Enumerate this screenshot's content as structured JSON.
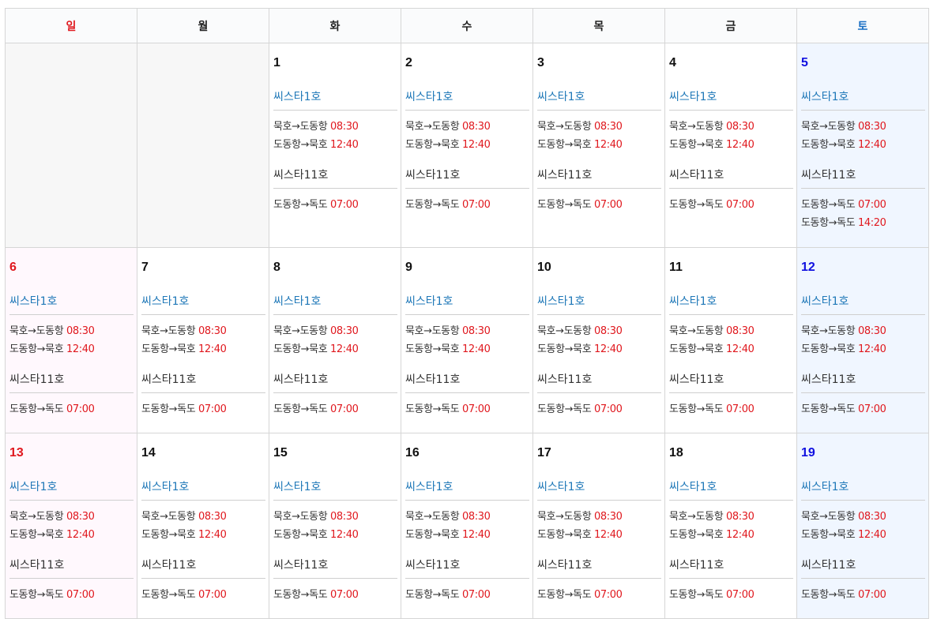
{
  "weekdays": [
    "일",
    "월",
    "화",
    "수",
    "목",
    "금",
    "토"
  ],
  "ships": {
    "ship1": "씨스타1호",
    "ship2": "씨스타11호"
  },
  "routes": {
    "mukho_dodong": "묵호→도동항",
    "dodong_mukho": "도동항→묵호",
    "dodong_dokdo": "도동항→독도"
  },
  "colors": {
    "sunday": "#e0181e",
    "saturday": "#1010e0",
    "time": "#e0181e",
    "ship1": "#1f78b8"
  },
  "weeks": [
    [
      null,
      null,
      {
        "day": "1",
        "ship1": [
          {
            "route": "묵호→도동항",
            "time": "08:30"
          },
          {
            "route": "도동항→묵호",
            "time": "12:40"
          }
        ],
        "ship2": [
          {
            "route": "도동항→독도",
            "time": "07:00"
          }
        ]
      },
      {
        "day": "2",
        "ship1": [
          {
            "route": "묵호→도동항",
            "time": "08:30"
          },
          {
            "route": "도동항→묵호",
            "time": "12:40"
          }
        ],
        "ship2": [
          {
            "route": "도동항→독도",
            "time": "07:00"
          }
        ]
      },
      {
        "day": "3",
        "ship1": [
          {
            "route": "묵호→도동항",
            "time": "08:30"
          },
          {
            "route": "도동항→묵호",
            "time": "12:40"
          }
        ],
        "ship2": [
          {
            "route": "도동항→독도",
            "time": "07:00"
          }
        ]
      },
      {
        "day": "4",
        "ship1": [
          {
            "route": "묵호→도동항",
            "time": "08:30"
          },
          {
            "route": "도동항→묵호",
            "time": "12:40"
          }
        ],
        "ship2": [
          {
            "route": "도동항→독도",
            "time": "07:00"
          }
        ]
      },
      {
        "day": "5",
        "ship1": [
          {
            "route": "묵호→도동항",
            "time": "08:30"
          },
          {
            "route": "도동항→묵호",
            "time": "12:40"
          }
        ],
        "ship2": [
          {
            "route": "도동항→독도",
            "time": "07:00"
          },
          {
            "route": "도동항→독도",
            "time": "14:20"
          }
        ]
      }
    ],
    [
      {
        "day": "6",
        "ship1": [
          {
            "route": "묵호→도동항",
            "time": "08:30"
          },
          {
            "route": "도동항→묵호",
            "time": "12:40"
          }
        ],
        "ship2": [
          {
            "route": "도동항→독도",
            "time": "07:00"
          }
        ]
      },
      {
        "day": "7",
        "ship1": [
          {
            "route": "묵호→도동항",
            "time": "08:30"
          },
          {
            "route": "도동항→묵호",
            "time": "12:40"
          }
        ],
        "ship2": [
          {
            "route": "도동항→독도",
            "time": "07:00"
          }
        ]
      },
      {
        "day": "8",
        "ship1": [
          {
            "route": "묵호→도동항",
            "time": "08:30"
          },
          {
            "route": "도동항→묵호",
            "time": "12:40"
          }
        ],
        "ship2": [
          {
            "route": "도동항→독도",
            "time": "07:00"
          }
        ]
      },
      {
        "day": "9",
        "ship1": [
          {
            "route": "묵호→도동항",
            "time": "08:30"
          },
          {
            "route": "도동항→묵호",
            "time": "12:40"
          }
        ],
        "ship2": [
          {
            "route": "도동항→독도",
            "time": "07:00"
          }
        ]
      },
      {
        "day": "10",
        "ship1": [
          {
            "route": "묵호→도동항",
            "time": "08:30"
          },
          {
            "route": "도동항→묵호",
            "time": "12:40"
          }
        ],
        "ship2": [
          {
            "route": "도동항→독도",
            "time": "07:00"
          }
        ]
      },
      {
        "day": "11",
        "ship1": [
          {
            "route": "묵호→도동항",
            "time": "08:30"
          },
          {
            "route": "도동항→묵호",
            "time": "12:40"
          }
        ],
        "ship2": [
          {
            "route": "도동항→독도",
            "time": "07:00"
          }
        ]
      },
      {
        "day": "12",
        "ship1": [
          {
            "route": "묵호→도동항",
            "time": "08:30"
          },
          {
            "route": "도동항→묵호",
            "time": "12:40"
          }
        ],
        "ship2": [
          {
            "route": "도동항→독도",
            "time": "07:00"
          }
        ]
      }
    ],
    [
      {
        "day": "13",
        "ship1": [
          {
            "route": "묵호→도동항",
            "time": "08:30"
          },
          {
            "route": "도동항→묵호",
            "time": "12:40"
          }
        ],
        "ship2": [
          {
            "route": "도동항→독도",
            "time": "07:00"
          }
        ]
      },
      {
        "day": "14",
        "ship1": [
          {
            "route": "묵호→도동항",
            "time": "08:30"
          },
          {
            "route": "도동항→묵호",
            "time": "12:40"
          }
        ],
        "ship2": [
          {
            "route": "도동항→독도",
            "time": "07:00"
          }
        ]
      },
      {
        "day": "15",
        "ship1": [
          {
            "route": "묵호→도동항",
            "time": "08:30"
          },
          {
            "route": "도동항→묵호",
            "time": "12:40"
          }
        ],
        "ship2": [
          {
            "route": "도동항→독도",
            "time": "07:00"
          }
        ]
      },
      {
        "day": "16",
        "ship1": [
          {
            "route": "묵호→도동항",
            "time": "08:30"
          },
          {
            "route": "도동항→묵호",
            "time": "12:40"
          }
        ],
        "ship2": [
          {
            "route": "도동항→독도",
            "time": "07:00"
          }
        ]
      },
      {
        "day": "17",
        "ship1": [
          {
            "route": "묵호→도동항",
            "time": "08:30"
          },
          {
            "route": "도동항→묵호",
            "time": "12:40"
          }
        ],
        "ship2": [
          {
            "route": "도동항→독도",
            "time": "07:00"
          }
        ]
      },
      {
        "day": "18",
        "ship1": [
          {
            "route": "묵호→도동항",
            "time": "08:30"
          },
          {
            "route": "도동항→묵호",
            "time": "12:40"
          }
        ],
        "ship2": [
          {
            "route": "도동항→독도",
            "time": "07:00"
          }
        ]
      },
      {
        "day": "19",
        "ship1": [
          {
            "route": "묵호→도동항",
            "time": "08:30"
          },
          {
            "route": "도동항→묵호",
            "time": "12:40"
          }
        ],
        "ship2": [
          {
            "route": "도동항→독도",
            "time": "07:00"
          }
        ]
      }
    ]
  ]
}
